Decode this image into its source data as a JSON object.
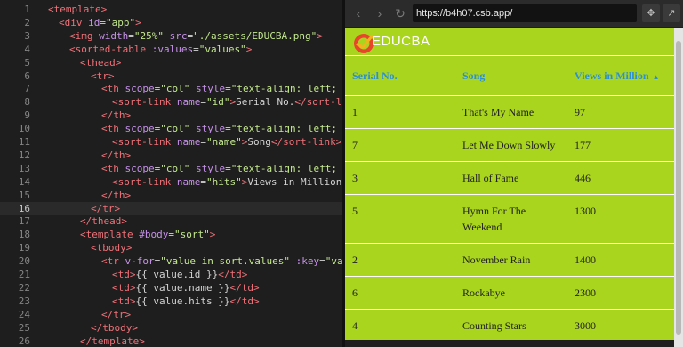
{
  "editor": {
    "lines": [
      {
        "n": "1",
        "segs": [
          [
            "tag",
            "<template>"
          ]
        ]
      },
      {
        "n": "2",
        "segs": [
          [
            "tag",
            "<div "
          ],
          [
            "attr",
            "id"
          ],
          [
            "txt",
            "="
          ],
          [
            "str",
            "\"app\""
          ],
          [
            "tag",
            ">"
          ]
        ]
      },
      {
        "n": "3",
        "segs": [
          [
            "tag",
            "<img "
          ],
          [
            "attr",
            "width"
          ],
          [
            "txt",
            "="
          ],
          [
            "str",
            "\"25%\""
          ],
          [
            "txt",
            " "
          ],
          [
            "attr",
            "src"
          ],
          [
            "txt",
            "="
          ],
          [
            "str",
            "\"./assets/EDUCBA.png\""
          ],
          [
            "tag",
            ">"
          ]
        ]
      },
      {
        "n": "4",
        "segs": [
          [
            "tag",
            "<sorted-table "
          ],
          [
            "attr",
            ":values"
          ],
          [
            "txt",
            "="
          ],
          [
            "str",
            "\"values\""
          ],
          [
            "tag",
            ">"
          ]
        ]
      },
      {
        "n": "5",
        "segs": [
          [
            "tag",
            "<thead>"
          ]
        ]
      },
      {
        "n": "6",
        "segs": [
          [
            "tag",
            "<tr>"
          ]
        ]
      },
      {
        "n": "7",
        "segs": [
          [
            "tag",
            "<th "
          ],
          [
            "attr",
            "scope"
          ],
          [
            "txt",
            "="
          ],
          [
            "str",
            "\"col\""
          ],
          [
            "txt",
            " "
          ],
          [
            "attr",
            "style"
          ],
          [
            "txt",
            "="
          ],
          [
            "str",
            "\"text-align: left; wid"
          ]
        ]
      },
      {
        "n": "8",
        "segs": [
          [
            "tag",
            "<sort-link "
          ],
          [
            "attr",
            "name"
          ],
          [
            "txt",
            "="
          ],
          [
            "str",
            "\"id\""
          ],
          [
            "tag",
            ">"
          ],
          [
            "txt",
            "Serial No."
          ],
          [
            "tag",
            "</sort-link"
          ]
        ]
      },
      {
        "n": "9",
        "segs": [
          [
            "tag",
            "</th>"
          ]
        ]
      },
      {
        "n": "10",
        "segs": [
          [
            "tag",
            "<th "
          ],
          [
            "attr",
            "scope"
          ],
          [
            "txt",
            "="
          ],
          [
            "str",
            "\"col\""
          ],
          [
            "txt",
            " "
          ],
          [
            "attr",
            "style"
          ],
          [
            "txt",
            "="
          ],
          [
            "str",
            "\"text-align: left; wid"
          ]
        ]
      },
      {
        "n": "11",
        "segs": [
          [
            "tag",
            "<sort-link "
          ],
          [
            "attr",
            "name"
          ],
          [
            "txt",
            "="
          ],
          [
            "str",
            "\"name\""
          ],
          [
            "tag",
            ">"
          ],
          [
            "txt",
            "Song"
          ],
          [
            "tag",
            "</sort-link>"
          ]
        ]
      },
      {
        "n": "12",
        "segs": [
          [
            "tag",
            "</th>"
          ]
        ]
      },
      {
        "n": "13",
        "segs": [
          [
            "tag",
            "<th "
          ],
          [
            "attr",
            "scope"
          ],
          [
            "txt",
            "="
          ],
          [
            "str",
            "\"col\""
          ],
          [
            "txt",
            " "
          ],
          [
            "attr",
            "style"
          ],
          [
            "txt",
            "="
          ],
          [
            "str",
            "\"text-align: left; wid"
          ]
        ]
      },
      {
        "n": "14",
        "segs": [
          [
            "tag",
            "<sort-link "
          ],
          [
            "attr",
            "name"
          ],
          [
            "txt",
            "="
          ],
          [
            "str",
            "\"hits\""
          ],
          [
            "tag",
            ">"
          ],
          [
            "txt",
            "Views in Million"
          ],
          [
            "tag",
            "</s"
          ]
        ]
      },
      {
        "n": "15",
        "segs": [
          [
            "tag",
            "</th>"
          ]
        ]
      },
      {
        "n": "16",
        "segs": [
          [
            "tag",
            "</tr>"
          ]
        ]
      },
      {
        "n": "17",
        "segs": [
          [
            "tag",
            "</thead>"
          ]
        ]
      },
      {
        "n": "18",
        "segs": [
          [
            "tag",
            "<template "
          ],
          [
            "attr",
            "#body"
          ],
          [
            "txt",
            "="
          ],
          [
            "str",
            "\"sort\""
          ],
          [
            "tag",
            ">"
          ]
        ]
      },
      {
        "n": "19",
        "segs": [
          [
            "tag",
            "<tbody>"
          ]
        ]
      },
      {
        "n": "20",
        "segs": [
          [
            "tag",
            "<tr "
          ],
          [
            "attr",
            "v-for"
          ],
          [
            "txt",
            "="
          ],
          [
            "str",
            "\"value in sort.values\""
          ],
          [
            "txt",
            " "
          ],
          [
            "attr",
            ":key"
          ],
          [
            "txt",
            "="
          ],
          [
            "str",
            "\"value"
          ]
        ]
      },
      {
        "n": "21",
        "segs": [
          [
            "tag",
            "<td>"
          ],
          [
            "txt",
            "{{ value.id }}"
          ],
          [
            "tag",
            "</td>"
          ]
        ]
      },
      {
        "n": "22",
        "segs": [
          [
            "tag",
            "<td>"
          ],
          [
            "txt",
            "{{ value.name }}"
          ],
          [
            "tag",
            "</td>"
          ]
        ]
      },
      {
        "n": "23",
        "segs": [
          [
            "tag",
            "<td>"
          ],
          [
            "txt",
            "{{ value.hits }}"
          ],
          [
            "tag",
            "</td>"
          ]
        ]
      },
      {
        "n": "24",
        "segs": [
          [
            "tag",
            "</tr>"
          ]
        ]
      },
      {
        "n": "25",
        "segs": [
          [
            "tag",
            "</tbody>"
          ]
        ]
      },
      {
        "n": "26",
        "segs": [
          [
            "tag",
            "</template>"
          ]
        ]
      }
    ],
    "active_line": "16"
  },
  "browser": {
    "url": "https://b4h07.csb.app/",
    "back_icon": "arrow-left-icon",
    "forward_icon": "arrow-right-icon",
    "reload_icon": "reload-icon",
    "move_icon": "move-icon",
    "popout_icon": "open-external-icon"
  },
  "page": {
    "brand": "EDUCBA",
    "headers": {
      "serial": "Serial No.",
      "song": "Song",
      "views": "Views in Million"
    },
    "rows": [
      {
        "id": "1",
        "name": "That's My Name",
        "hits": "97"
      },
      {
        "id": "7",
        "name": "Let Me Down Slowly",
        "hits": "177"
      },
      {
        "id": "3",
        "name": "Hall of Fame",
        "hits": "446"
      },
      {
        "id": "5",
        "name": "Hymn For The Weekend",
        "hits": "1300"
      },
      {
        "id": "2",
        "name": "November Rain",
        "hits": "1400"
      },
      {
        "id": "6",
        "name": "Rockabye",
        "hits": "2300"
      },
      {
        "id": "4",
        "name": "Counting Stars",
        "hits": "3000"
      }
    ]
  },
  "colors": {
    "page_bg": "#a9d51f",
    "header_text": "#2a8fd8",
    "logo": "#e8452c"
  }
}
